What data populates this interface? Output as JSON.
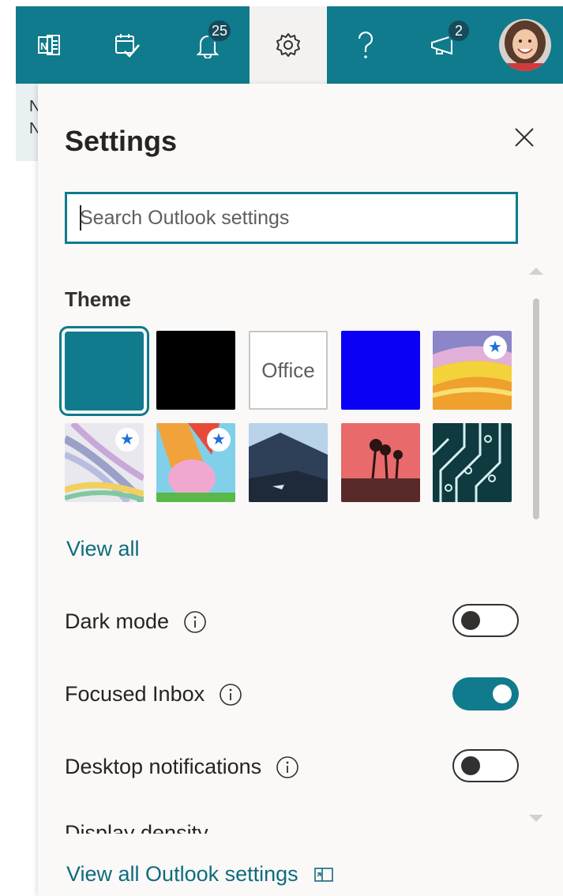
{
  "topbar": {
    "notifications_count": "25",
    "feedback_count": "2",
    "icons": [
      "onenote-icon",
      "todo-icon",
      "bell-icon",
      "gear-icon",
      "help-icon",
      "megaphone-icon",
      "avatar"
    ]
  },
  "leftstrip": {
    "line1": "N",
    "line2": "N"
  },
  "settings": {
    "title": "Settings",
    "search_placeholder": "Search Outlook settings",
    "theme_heading": "Theme",
    "office_tile_label": "Office",
    "view_all": "View all",
    "toggles": [
      {
        "label": "Dark mode",
        "on": false
      },
      {
        "label": "Focused Inbox",
        "on": true
      },
      {
        "label": "Desktop notifications",
        "on": false
      }
    ],
    "cut_row_label": "Display density",
    "footer_link": "View all Outlook settings"
  },
  "colors": {
    "accent": "#0f7b8c",
    "link": "#0f6c7c",
    "panel_bg": "#faf9f8"
  }
}
